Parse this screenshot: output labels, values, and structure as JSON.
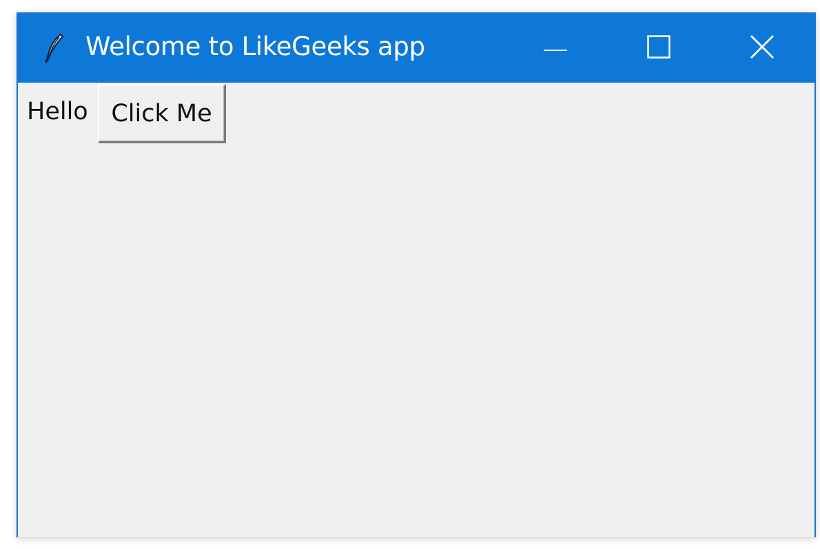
{
  "window": {
    "title": "Welcome to LikeGeeks app",
    "icon": "feather-icon",
    "controls": {
      "minimize_icon": "minimize-icon",
      "maximize_icon": "maximize-icon",
      "close_icon": "close-icon"
    }
  },
  "content": {
    "label_text": "Hello",
    "button_label": "Click Me"
  },
  "colors": {
    "titlebar": "#0d78d8",
    "client_bg": "#f0eff0",
    "title_text": "#ffffff"
  }
}
